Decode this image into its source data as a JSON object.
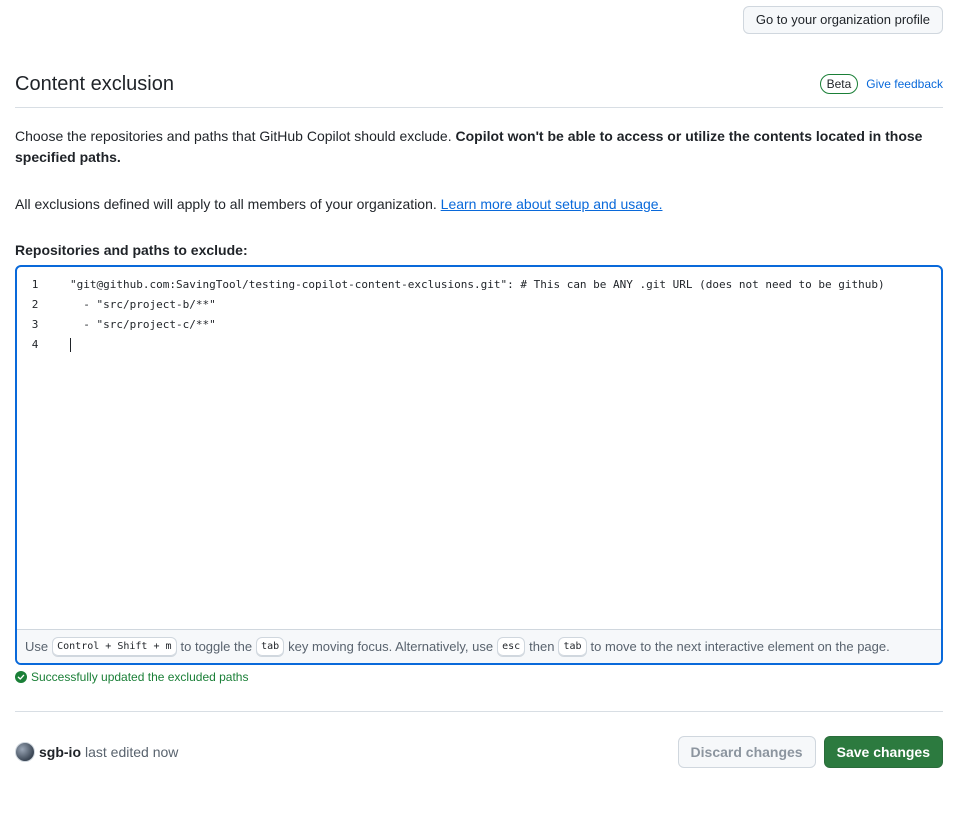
{
  "top": {
    "org_profile_button": "Go to your organization profile"
  },
  "header": {
    "title": "Content exclusion",
    "beta_badge": "Beta",
    "feedback_link": "Give feedback"
  },
  "description": {
    "intro": "Choose the repositories and paths that GitHub Copilot should exclude. ",
    "intro_bold": "Copilot won't be able to access or utilize the contents located in those specified paths.",
    "scope": "All exclusions defined will apply to all members of your organization. ",
    "learn_more_link": "Learn more about setup and usage."
  },
  "editor": {
    "label": "Repositories and paths to exclude:",
    "lines": [
      {
        "num": "1",
        "text": "\"git@github.com:SavingTool/testing-copilot-content-exclusions.git\": # This can be ANY .git URL (does not need to be github)"
      },
      {
        "num": "2",
        "text": "  - \"src/project-b/**\""
      },
      {
        "num": "3",
        "text": "  - \"src/project-c/**\""
      },
      {
        "num": "4",
        "text": ""
      }
    ],
    "footer": {
      "t1": "Use",
      "k1": "Control + Shift + m",
      "t2": "to toggle the",
      "k2": "tab",
      "t3": "key moving focus. Alternatively, use",
      "k3": "esc",
      "t4": "then",
      "k4": "tab",
      "t5": "to move to the next interactive element on the page."
    }
  },
  "status": {
    "success_message": "Successfully updated the excluded paths",
    "success_color": "#1a7f37"
  },
  "edit_info": {
    "username": "sgb-io",
    "suffix": "last edited now"
  },
  "actions": {
    "discard_label": "Discard changes",
    "save_label": "Save changes",
    "save_color": "#2c7a3f"
  }
}
